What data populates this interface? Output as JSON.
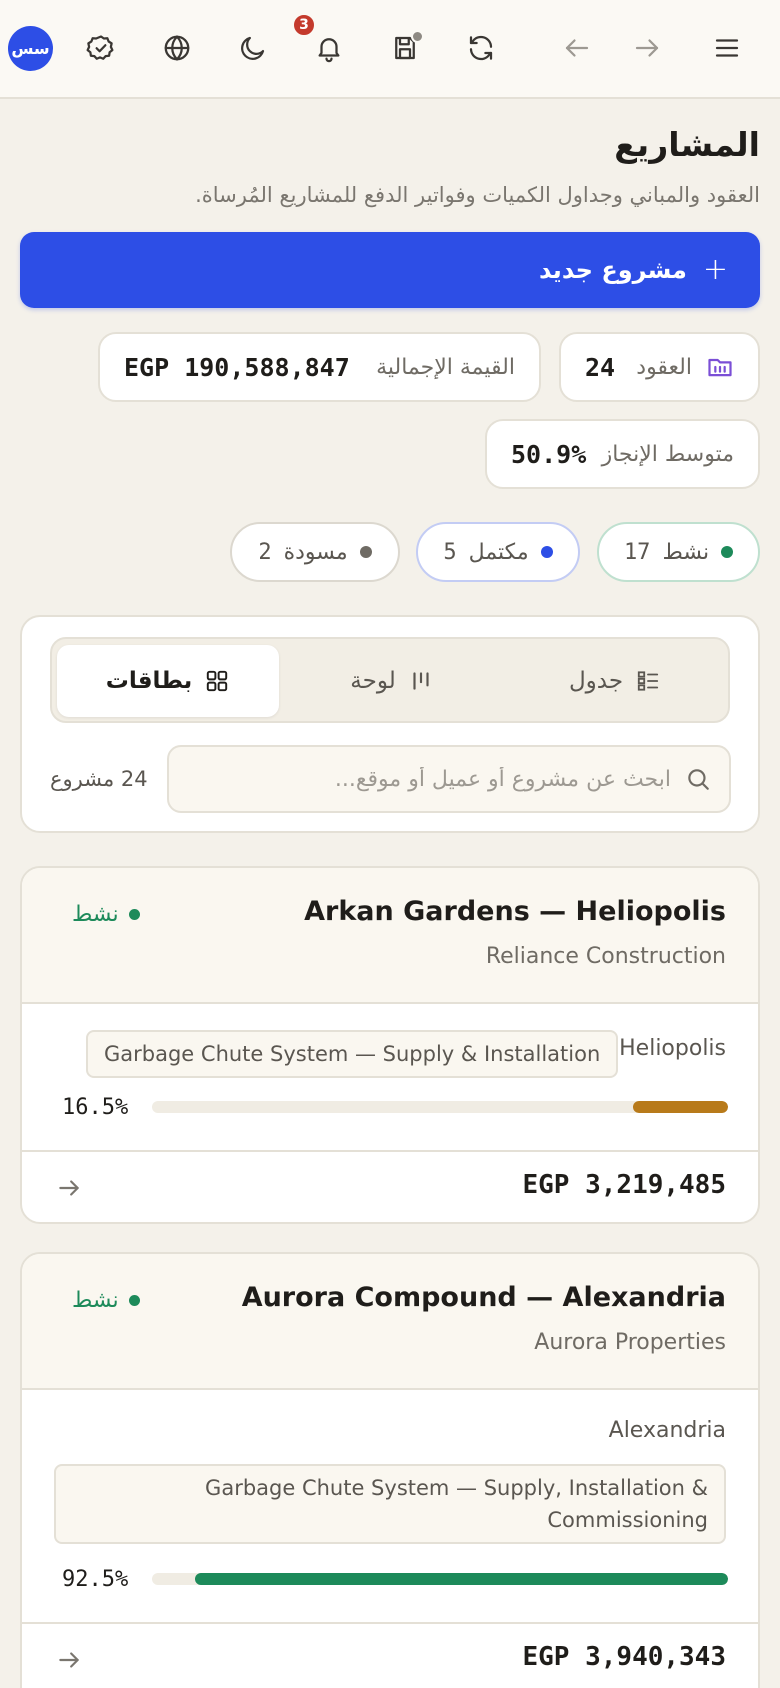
{
  "topbar": {
    "avatar_initials": "سس",
    "notification_count": "3",
    "icons": [
      "avatar",
      "badge-check-icon",
      "globe-icon",
      "moon-icon",
      "bell-icon",
      "save-icon",
      "refresh-icon",
      "arrow-left-icon",
      "arrow-right-icon",
      "menu-icon"
    ]
  },
  "header": {
    "title": "المشاريع",
    "subtitle": "العقود والمباني وجداول الكميات وفواتير الدفع للمشاريع المُرساة."
  },
  "new_project_button": {
    "label": "مشروع جديد",
    "icon": "plus-icon"
  },
  "stats": {
    "contracts": {
      "label": "العقود",
      "value": "24",
      "icon": "folder-icon"
    },
    "total_value": {
      "label": "القيمة الإجمالية",
      "value": "EGP 190,588,847"
    },
    "avg_completion": {
      "label": "متوسط الإنجاز",
      "value": "50.9%"
    }
  },
  "status_filters": [
    {
      "label": "نشط",
      "count": "17",
      "color": "#1d8a5a"
    },
    {
      "label": "مكتمل",
      "count": "5",
      "color": "#2d4ee6"
    },
    {
      "label": "مسودة",
      "count": "2",
      "color": "#6f6b64"
    }
  ],
  "views": {
    "table": "جدول",
    "board": "لوحة",
    "cards": "بطاقات",
    "active": "cards"
  },
  "search": {
    "placeholder": "ابحث عن مشروع أو عميل أو موقع...",
    "value": "",
    "count_label": "24 مشروع"
  },
  "projects": [
    {
      "name": "Arkan Gardens — Heliopolis",
      "client": "Reliance Construction",
      "status": "نشط",
      "location": "Heliopolis",
      "scope": "Garbage Chute System — Supply & Installation",
      "progress_label": "16.5%",
      "progress": 16.5,
      "progress_color": "#b87a1a",
      "value": "EGP 3,219,485"
    },
    {
      "name": "Aurora Compound — Alexandria",
      "client": "Aurora Properties",
      "status": "نشط",
      "location": "Alexandria",
      "scope": "Garbage Chute System — Supply, Installation & Commissioning",
      "progress_label": "92.5%",
      "progress": 92.5,
      "progress_color": "#1d8a5a",
      "value": "EGP 3,940,343"
    }
  ]
}
